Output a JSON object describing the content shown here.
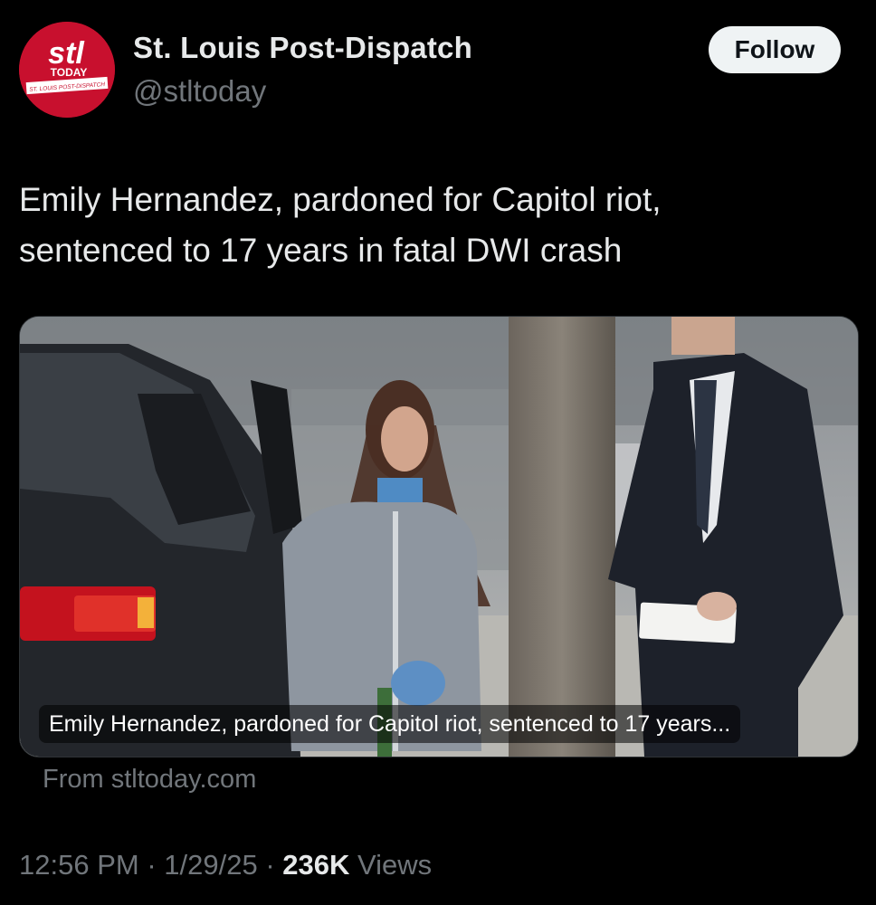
{
  "account": {
    "name": "St. Louis Post-Dispatch",
    "handle": "@stltoday",
    "avatar": {
      "logo_text": "stl",
      "sub_text": "TODAY",
      "banner_text": "ST. LOUIS POST-DISPATCH",
      "background_color": "#c8102e"
    }
  },
  "follow_button": {
    "label": "Follow"
  },
  "tweet": {
    "text_line1": "Emily Hernandez, pardoned for Capitol riot,",
    "text_line2": "sentenced to 17 years in fatal DWI crash"
  },
  "link_card": {
    "caption": "Emily Hernandez, pardoned for Capitol riot, sentenced to 17 years...",
    "source": "From stltoday.com"
  },
  "meta": {
    "time": "12:56 PM",
    "separator": "·",
    "date": "1/29/25",
    "views_count": "236K",
    "views_label": "Views"
  },
  "colors": {
    "background": "#000000",
    "text_primary": "#e7e9ea",
    "text_secondary": "#71767b",
    "follow_bg": "#eff3f4"
  }
}
